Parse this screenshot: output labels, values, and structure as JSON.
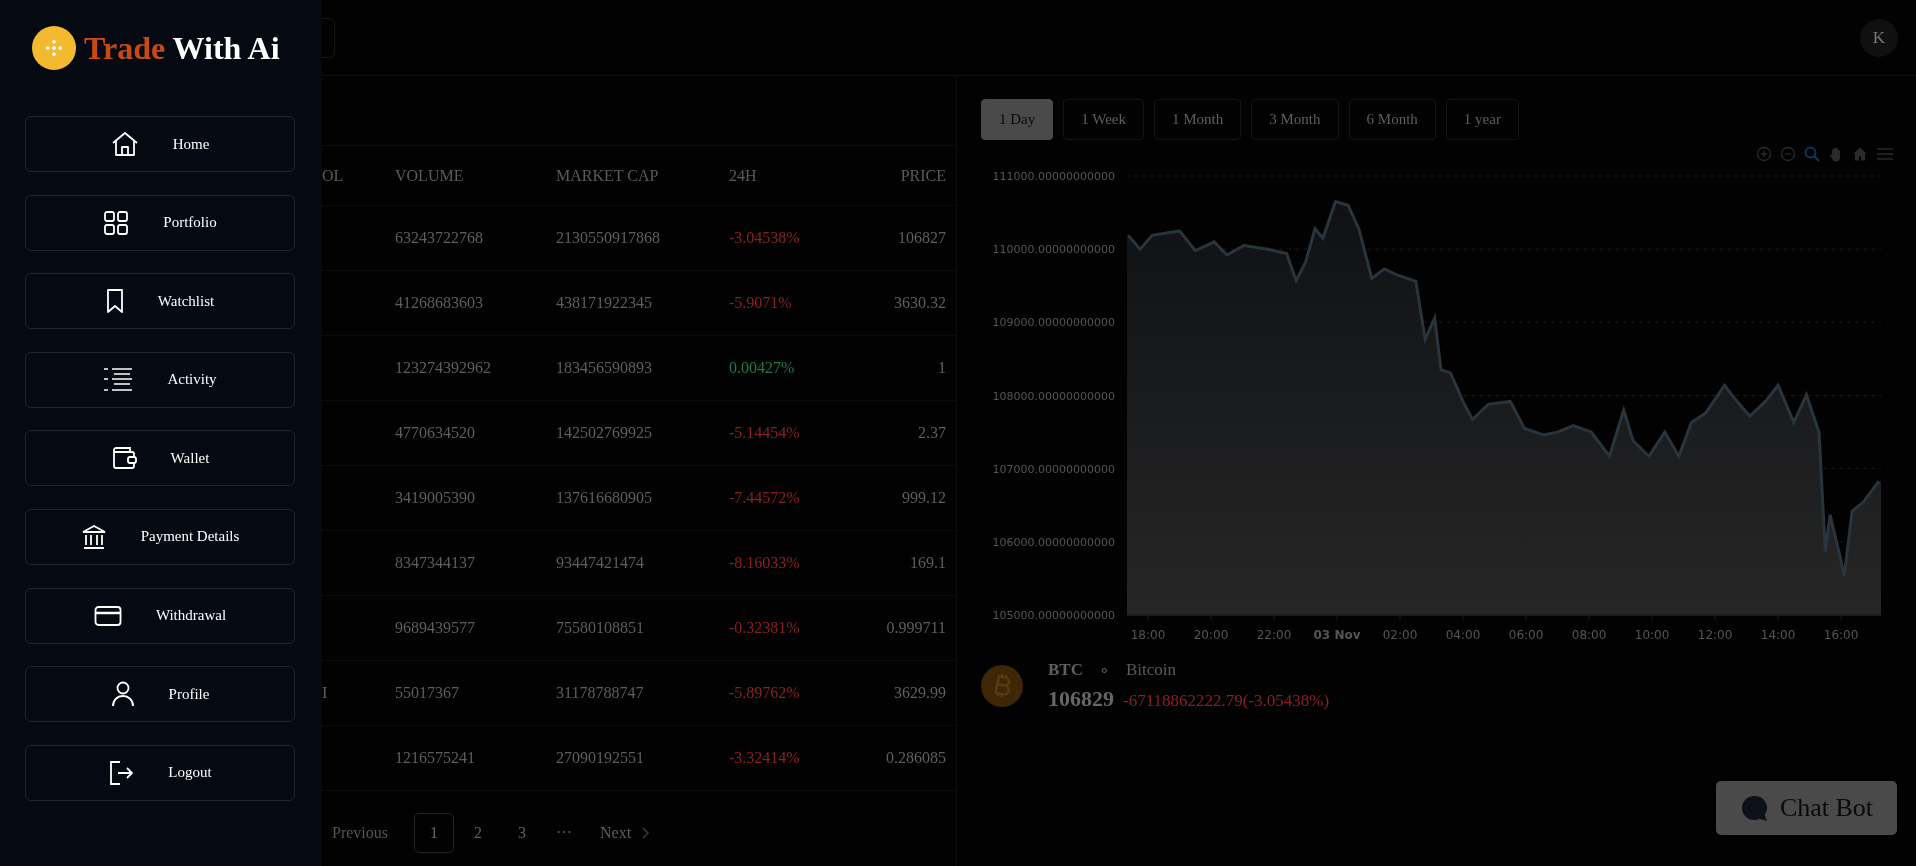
{
  "header": {
    "avatar": "K"
  },
  "sidebar": {
    "logo": {
      "first": "Trade",
      "second": "With Ai"
    },
    "items": [
      {
        "label": "Home",
        "kind": "home"
      },
      {
        "label": "Portfolio",
        "kind": "grid"
      },
      {
        "label": "Watchlist",
        "kind": "bookmark"
      },
      {
        "label": "Activity",
        "kind": "list"
      },
      {
        "label": "Wallet",
        "kind": "wallet"
      },
      {
        "label": "Payment Details",
        "kind": "bank"
      },
      {
        "label": "Withdrawal",
        "kind": "card"
      },
      {
        "label": "Profile",
        "kind": "user"
      },
      {
        "label": "Logout",
        "kind": "logout"
      }
    ]
  },
  "table": {
    "columns": [
      "OL",
      "VOLUME",
      "MARKET CAP",
      "24H",
      "PRICE"
    ],
    "rows": [
      {
        "volume": "63243722768",
        "market_cap": "2130550917868",
        "change": "-3.04538%",
        "color": "#8a2020",
        "price": "106827"
      },
      {
        "volume": "41268683603",
        "market_cap": "438171922345",
        "change": "-5.9071%",
        "color": "#8a2020",
        "price": "3630.32"
      },
      {
        "volume": "123274392962",
        "market_cap": "183456590893",
        "change": "0.00427%",
        "color": "#1f7a44",
        "price": "1"
      },
      {
        "volume": "4770634520",
        "market_cap": "142502769925",
        "change": "-5.14454%",
        "color": "#8a2020",
        "price": "2.37"
      },
      {
        "volume": "3419005390",
        "market_cap": "137616680905",
        "change": "-7.44572%",
        "color": "#8a2020",
        "price": "999.12"
      },
      {
        "volume": "8347344137",
        "market_cap": "93447421474",
        "change": "-8.16033%",
        "color": "#8a2020",
        "price": "169.1"
      },
      {
        "volume": "9689439577",
        "market_cap": "75580108851",
        "change": "-0.32381%",
        "color": "#8a2020",
        "price": "0.999711"
      },
      {
        "symbol": "I",
        "volume": "55017367",
        "market_cap": "31178788747",
        "change": "-5.89762%",
        "color": "#8a2020",
        "price": "3629.99"
      },
      {
        "volume": "1216575241",
        "market_cap": "27090192551",
        "change": "-3.32414%",
        "color": "#8a2020",
        "price": "0.286085"
      }
    ],
    "pagination": {
      "previous": "Previous",
      "pages": [
        {
          "label": "1",
          "selected": true
        },
        {
          "label": "2",
          "selected": false
        },
        {
          "label": "3",
          "selected": false
        }
      ],
      "ellipsis": "···",
      "next": "Next"
    }
  },
  "chart_panel": {
    "ranges": [
      {
        "label": "1 Day",
        "selected": true
      },
      {
        "label": "1 Week",
        "selected": false
      },
      {
        "label": "1 Month",
        "selected": false
      },
      {
        "label": "3 Month",
        "selected": false
      },
      {
        "label": "6 Month",
        "selected": false
      },
      {
        "label": "1 year",
        "selected": false
      }
    ],
    "chart_data": {
      "type": "area",
      "grid": true,
      "xlim": [
        "--11-02T17:20",
        "--11-03T17:16"
      ],
      "ylim": [
        105000,
        111000
      ],
      "xticks": [
        {
          "value": "--11-02T18:00",
          "label": "18:00"
        },
        {
          "value": "--11-02T20:00",
          "label": "20:00"
        },
        {
          "value": "--11-02T22:00",
          "label": "22:00"
        },
        {
          "value": "--11-03T00:00",
          "label": "03 Nov"
        },
        {
          "value": "--11-03T02:00",
          "label": "02:00"
        },
        {
          "value": "--11-03T04:00",
          "label": "04:00"
        },
        {
          "value": "--11-03T06:00",
          "label": "06:00"
        },
        {
          "value": "--11-03T08:00",
          "label": "08:00"
        },
        {
          "value": "--11-03T10:00",
          "label": "10:00"
        },
        {
          "value": "--11-03T12:00",
          "label": "12:00"
        },
        {
          "value": "--11-03T14:00",
          "label": "14:00"
        },
        {
          "value": "--11-03T16:00",
          "label": "16:00"
        }
      ],
      "yticks": [
        {
          "value": 105000,
          "label": "105000.00000000000"
        },
        {
          "value": 106000,
          "label": "106000.00000000000"
        },
        {
          "value": 107000,
          "label": "107000.00000000000"
        },
        {
          "value": 108000,
          "label": "108000.00000000000"
        },
        {
          "value": 109000,
          "label": "109000.00000000000"
        },
        {
          "value": 110000,
          "label": "110000.00000000000"
        },
        {
          "value": 111000,
          "label": "111000.00000000000"
        }
      ],
      "x": [
        "--11-02T17:22",
        "--11-02T17:45",
        "--11-02T18:08",
        "--11-02T19:00",
        "--11-02T19:30",
        "--11-02T20:06",
        "--11-02T20:30",
        "--11-02T21:03",
        "--11-02T21:48",
        "--11-02T22:24",
        "--11-02T22:42",
        "--11-02T23:00",
        "--11-02T23:18",
        "--11-02T23:33",
        "--11-02T23:57",
        "--11-03T00:21",
        "--11-03T00:42",
        "--11-03T01:06",
        "--11-03T01:30",
        "--11-03T01:54",
        "--11-03T02:30",
        "--11-03T02:48",
        "--11-03T03:06",
        "--11-03T03:18",
        "--11-03T03:36",
        "--11-03T04:00",
        "--11-03T04:18",
        "--11-03T04:48",
        "--11-03T05:30",
        "--11-03T05:57",
        "--11-03T06:33",
        "--11-03T07:00",
        "--11-03T07:30",
        "--11-03T08:04",
        "--11-03T08:39",
        "--11-03T09:06",
        "--11-03T09:24",
        "--11-03T09:54",
        "--11-03T10:24",
        "--11-03T10:51",
        "--11-03T11:15",
        "--11-03T11:42",
        "--11-03T12:18",
        "--11-03T12:36",
        "--11-03T13:06",
        "--11-03T13:36",
        "--11-03T14:00",
        "--11-03T14:30",
        "--11-03T14:54",
        "--11-03T15:18",
        "--11-03T15:30",
        "--11-03T15:39",
        "--11-03T15:57",
        "--11-03T16:06",
        "--11-03T16:21",
        "--11-03T16:42",
        "--11-03T17:12"
      ],
      "series": [
        {
          "color": "#2a343b",
          "values": [
            110190,
            110000,
            110190,
            110250,
            109980,
            110100,
            109920,
            110050,
            110000,
            109940,
            109570,
            109820,
            110280,
            110150,
            110650,
            110600,
            110270,
            109600,
            109730,
            109650,
            109560,
            108770,
            109060,
            108350,
            108310,
            107920,
            107670,
            107880,
            107920,
            107550,
            107460,
            107500,
            107590,
            107500,
            107170,
            107800,
            107380,
            107170,
            107500,
            107170,
            107630,
            107760,
            108140,
            107970,
            107720,
            107920,
            108140,
            107630,
            108010,
            107500,
            105870,
            106370,
            105830,
            105530,
            106420,
            106540,
            106830
          ]
        }
      ]
    },
    "asset": {
      "symbol": "BTC",
      "separator": "∘",
      "name": "Bitcoin",
      "price": "106829",
      "change": "-67118862222.79(-3.05438%)",
      "color": "#8a2020"
    }
  },
  "chat_button": {
    "label": "Chat Bot"
  }
}
